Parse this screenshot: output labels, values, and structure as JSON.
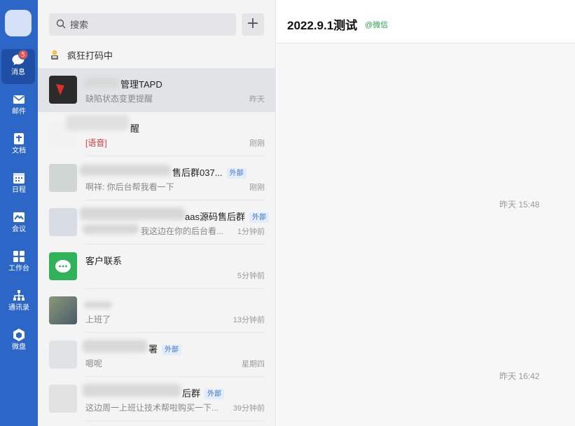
{
  "rail": {
    "items": [
      {
        "label": "消息",
        "icon": "message-icon",
        "badge": "5",
        "active": true
      },
      {
        "label": "邮件",
        "icon": "mail-icon"
      },
      {
        "label": "文档",
        "icon": "document-icon"
      },
      {
        "label": "日程",
        "icon": "calendar-icon"
      },
      {
        "label": "会议",
        "icon": "meeting-icon"
      },
      {
        "label": "工作台",
        "icon": "workbench-icon"
      },
      {
        "label": "通讯录",
        "icon": "contacts-icon"
      },
      {
        "label": "微盘",
        "icon": "drive-icon"
      }
    ]
  },
  "search": {
    "placeholder": "搜索"
  },
  "status": {
    "text": "疯狂打码中"
  },
  "conversations": [
    {
      "name": "管理TAPD",
      "preview": "缺陷状态变更提醒",
      "time": "昨天"
    },
    {
      "name": "醒",
      "preview": "[语音]",
      "time": "刚刚"
    },
    {
      "name": "售后群037...",
      "tag": "外部",
      "preview": "啊祥: 你后台帮我看一下",
      "time": "刚刚"
    },
    {
      "name": "aas源码售后群",
      "tag": "外部",
      "preview": "我这边在你的后台看...",
      "time": "1分钟前"
    },
    {
      "name": "客户联系",
      "preview": "",
      "time": "5分钟前"
    },
    {
      "name": "",
      "preview": "上班了",
      "time": "13分钟前"
    },
    {
      "name": "署",
      "tag": "外部",
      "preview": "嗯呢",
      "time": "星期四"
    },
    {
      "name": "后群",
      "tag": "外部",
      "preview": "这边周一上班让技术帮啦购买一下...",
      "time": "39分钟前"
    }
  ],
  "chat": {
    "title": "2022.9.1测试",
    "source": "@微信",
    "timestamps": [
      "昨天 15:48",
      "昨天 16:42"
    ]
  },
  "colors": {
    "rail": "#2c66c7",
    "accent_green": "#2aa34a",
    "tag_blue": "#3a74d1",
    "badge_red": "#f04b4b"
  }
}
